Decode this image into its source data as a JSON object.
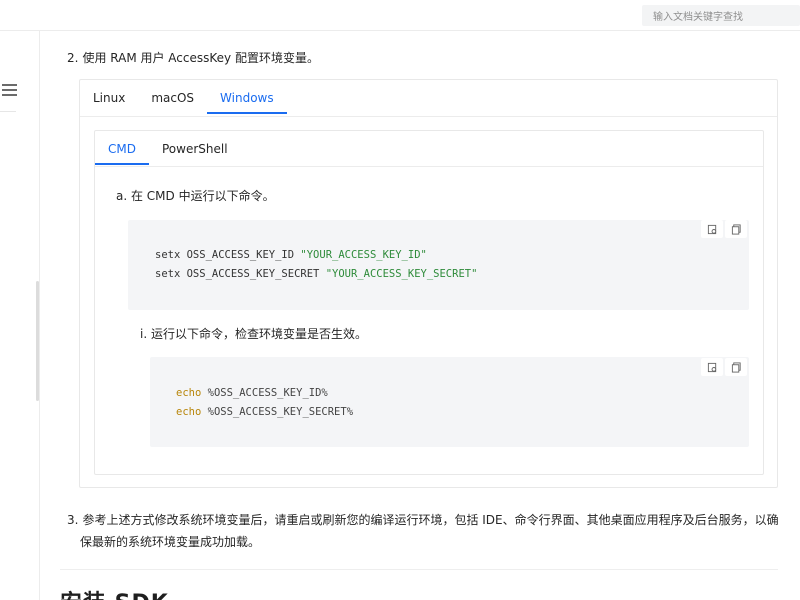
{
  "search": {
    "placeholder": "输入文档关键字查找"
  },
  "steps": {
    "step2": {
      "num": "2.",
      "text": "使用 RAM 用户 AccessKey 配置环境变量。"
    },
    "step3": {
      "num": "3.",
      "line1": "参考上述方式修改系统环境变量后，请重启或刷新您的编译运行环境，包括 IDE、命令行界面、其他桌面应用程序及后台服务，以确",
      "line2": "保最新的系统环境变量成功加载。"
    }
  },
  "os_tabs": [
    {
      "label": "Linux",
      "active": false
    },
    {
      "label": "macOS",
      "active": false
    },
    {
      "label": "Windows",
      "active": true
    }
  ],
  "shell_tabs": [
    {
      "label": "CMD",
      "active": true
    },
    {
      "label": "PowerShell",
      "active": false
    }
  ],
  "substep_a": {
    "text": "a. 在 CMD 中运行以下命令。"
  },
  "code1": {
    "line1_cmd": "setx OSS_ACCESS_KEY_ID ",
    "line1_str": "\"YOUR_ACCESS_KEY_ID\"",
    "line2_cmd": "setx OSS_ACCESS_KEY_SECRET ",
    "line2_str": "\"YOUR_ACCESS_KEY_SECRET\""
  },
  "substep_i": {
    "text": "i. 运行以下命令，检查环境变量是否生效。"
  },
  "code2": {
    "line1_kw": "echo",
    "line1_var": " %OSS_ACCESS_KEY_ID%",
    "line2_kw": "echo",
    "line2_var": " %OSS_ACCESS_KEY_SECRET%"
  },
  "section": {
    "heading": "安装 SDK"
  },
  "icons": {
    "menu": "menu-icon",
    "open_editor": "open-in-editor-icon",
    "copy": "copy-icon"
  },
  "colors": {
    "accent": "#1a6cf0",
    "string": "#2e8b3a",
    "keyword": "#b8860b",
    "code_bg": "#f4f5f7"
  }
}
